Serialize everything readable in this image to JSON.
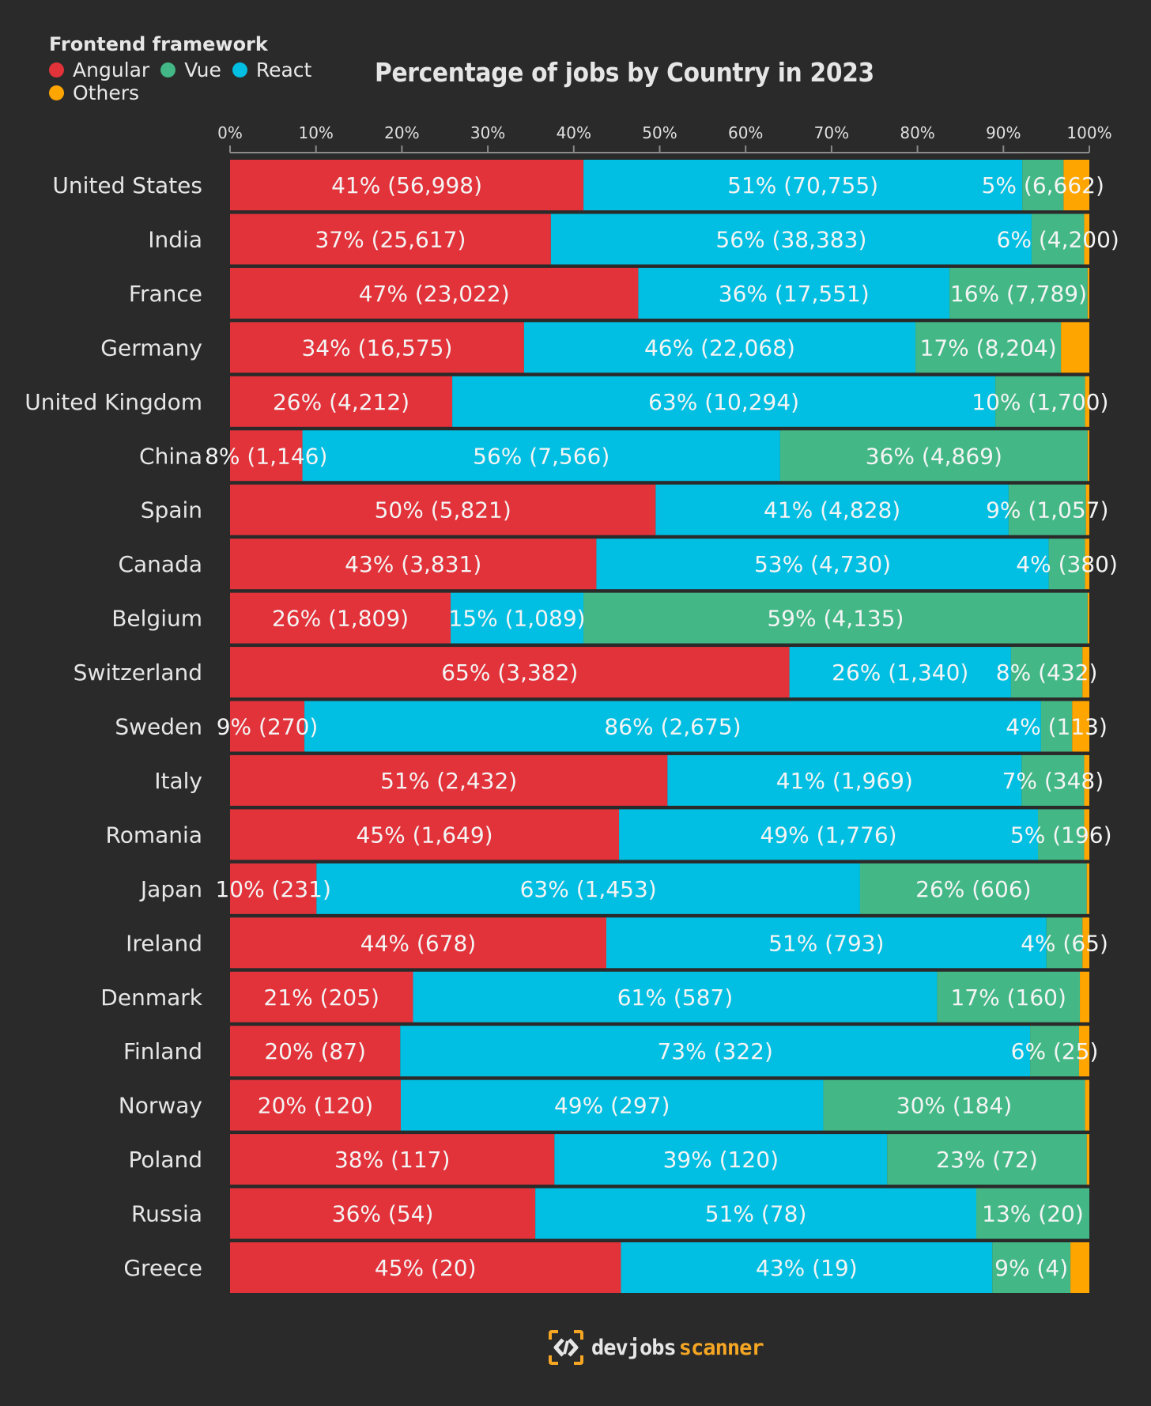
{
  "legend": {
    "title": "Frontend framework",
    "items": [
      {
        "name": "Angular",
        "color": "#e2323a"
      },
      {
        "name": "Vue",
        "color": "#43b886"
      },
      {
        "name": "React",
        "color": "#00bfe2"
      },
      {
        "name": "Others",
        "color": "#ffa500"
      }
    ]
  },
  "logo": {
    "part1": "devjobs",
    "part2": "scanner"
  },
  "chart_data": {
    "type": "bar",
    "orientation": "horizontal",
    "stacked": true,
    "normalized": true,
    "title": "Percentage of jobs by Country in 2023",
    "xlabel": "",
    "ylabel": "",
    "xlim": [
      0,
      100
    ],
    "x_ticks": [
      "0%",
      "10%",
      "20%",
      "30%",
      "40%",
      "50%",
      "60%",
      "70%",
      "80%",
      "90%",
      "100%"
    ],
    "legend_position": "top-left",
    "grid": false,
    "series_order": [
      "Angular",
      "React",
      "Vue",
      "Others"
    ],
    "colors": {
      "Angular": "#e2323a",
      "React": "#00bfe2",
      "Vue": "#43b886",
      "Others": "#ffa500"
    },
    "categories": [
      "United States",
      "India",
      "France",
      "Germany",
      "United Kingdom",
      "China",
      "Spain",
      "Canada",
      "Belgium",
      "Switzerland",
      "Sweden",
      "Italy",
      "Romania",
      "Japan",
      "Ireland",
      "Denmark",
      "Finland",
      "Norway",
      "Poland",
      "Russia",
      "Greece"
    ],
    "series": [
      {
        "name": "Angular",
        "percent": [
          41,
          37,
          47,
          34,
          26,
          8,
          50,
          43,
          26,
          65,
          9,
          51,
          45,
          10,
          44,
          21,
          20,
          20,
          38,
          36,
          45
        ],
        "counts": [
          "56,998",
          "25,617",
          "23,022",
          "16,575",
          "4,212",
          "1,146",
          "5,821",
          "3,831",
          "1,809",
          "3,382",
          "270",
          "2,432",
          "1,649",
          "231",
          "678",
          "205",
          "87",
          "120",
          "117",
          "54",
          "20"
        ]
      },
      {
        "name": "React",
        "percent": [
          51,
          56,
          36,
          46,
          63,
          56,
          41,
          53,
          15,
          26,
          86,
          41,
          49,
          63,
          51,
          61,
          73,
          49,
          39,
          51,
          43
        ],
        "counts": [
          "70,755",
          "38,383",
          "17,551",
          "22,068",
          "10,294",
          "7,566",
          "4,828",
          "4,730",
          "1,089",
          "1,340",
          "2,675",
          "1,969",
          "1,776",
          "1,453",
          "793",
          "587",
          "322",
          "297",
          "120",
          "78",
          "19"
        ]
      },
      {
        "name": "Vue",
        "percent": [
          5,
          6,
          16,
          17,
          10,
          36,
          9,
          4,
          59,
          8,
          4,
          7,
          5,
          26,
          4,
          17,
          6,
          30,
          23,
          13,
          9
        ],
        "counts": [
          "6,662",
          "4,200",
          "7,789",
          "8,204",
          "1,700",
          "4,869",
          "1,057",
          "380",
          "4,135",
          "432",
          "113",
          "348",
          "196",
          "606",
          "65",
          "160",
          "25",
          "184",
          "72",
          "20",
          "4"
        ]
      },
      {
        "name": "Others",
        "percent_estimated": [
          3.0,
          0.6,
          0.2,
          3.3,
          0.5,
          0.2,
          0.4,
          0.5,
          0.2,
          0.8,
          2.0,
          0.6,
          0.6,
          0.3,
          0.8,
          1.1,
          1.2,
          0.5,
          0.3,
          0.0,
          2.2
        ],
        "counts": null
      }
    ]
  }
}
